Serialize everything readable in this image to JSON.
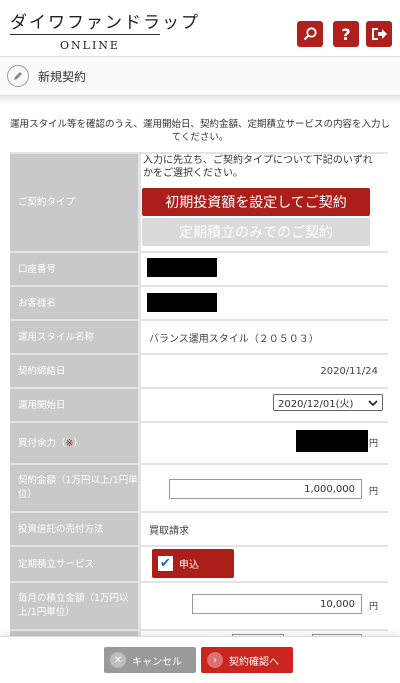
{
  "header": {
    "brand_main": "ダイワファンドラップ",
    "brand_sub": "ONLINE",
    "search_glyph": "⚲",
    "help_glyph": "?",
    "logout_glyph": "➜"
  },
  "page": {
    "title": "新規契約",
    "instruction": "運用スタイル等を確認のうえ、運用開始日、契約金額、定期積立サービスの内容を入力してください。"
  },
  "form": {
    "contract_type": {
      "label": "ご契約タイプ",
      "note": "入力に先立ち、ご契約タイプについて下記のいずれかをご選択ください。",
      "primary_button": "初期投資額を設定してご契約",
      "secondary_button": "定期積立のみでのご契約"
    },
    "account_number": {
      "label": "口座番号"
    },
    "customer_name": {
      "label": "お客様名"
    },
    "style_name": {
      "label": "運用スタイル名称",
      "value": "バランス運用スタイル（２０５０３）"
    },
    "contract_date": {
      "label": "契約締結日",
      "value": "2020/11/24"
    },
    "start_date": {
      "label": "運用開始日",
      "value": "2020/12/01(火)"
    },
    "buying_power": {
      "label_text": "買付余力（",
      "label_mark": "※",
      "label_end": "）",
      "unit": "円"
    },
    "contract_amount": {
      "label": "契約金額（1万円以上/1円単位）",
      "value": "1,000,000",
      "unit": "円"
    },
    "sell_method": {
      "label": "投資信託の売付方法",
      "value": "買取請求"
    },
    "periodic_service": {
      "label": "定期積立サービス",
      "check_label": "申込",
      "checked": true
    },
    "monthly_amount": {
      "label": "毎月の積立金額（1万円以上/1円単位）",
      "value": "10,000",
      "unit": "円"
    }
  },
  "footer": {
    "cancel": "キャンセル",
    "confirm": "契約確認へ"
  },
  "colors": {
    "brand_red": "#ab1e1a",
    "label_gray": "#c9c9c9",
    "button_disabled": "#dadada"
  }
}
